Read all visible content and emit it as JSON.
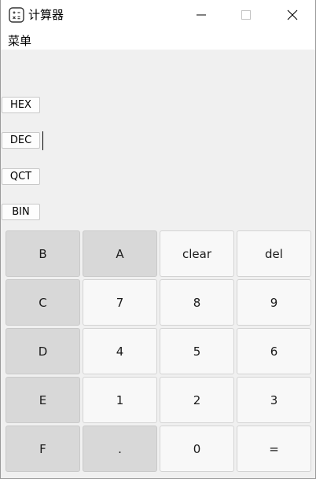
{
  "window": {
    "title": "计算器",
    "icon": "calculator-app-icon",
    "controls": [
      "minimize-icon",
      "maximize-icon",
      "close-icon"
    ]
  },
  "menu": {
    "label": "菜单"
  },
  "bases": {
    "hex": "HEX",
    "dec": "DEC",
    "oct": "QCT",
    "bin": "BIN"
  },
  "keypad": {
    "row1": [
      "B",
      "A",
      "clear",
      "del"
    ],
    "row2": [
      "C",
      "7",
      "8",
      "9"
    ],
    "row3": [
      "D",
      "4",
      "5",
      "6"
    ],
    "row4": [
      "E",
      "1",
      "2",
      "3"
    ],
    "row5": [
      "F",
      ".",
      "0",
      "="
    ]
  },
  "colors": {
    "hex_key_bg": "#d8d8d8",
    "num_key_bg": "#f8f8f8",
    "client_bg": "#f0f0f0"
  }
}
